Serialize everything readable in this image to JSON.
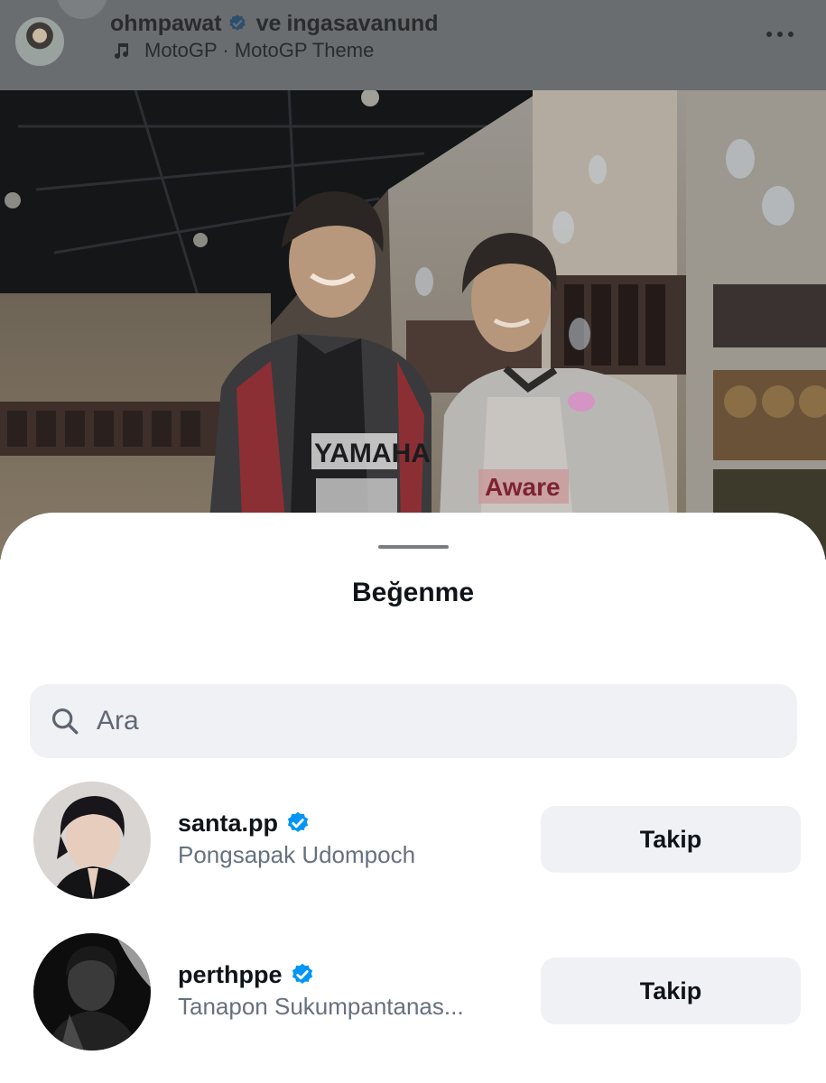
{
  "post_header": {
    "user_a": "ohmpawat",
    "joiner": "ve",
    "user_b": "ingasavanund",
    "music_label": "MotoGP · MotoGP Theme",
    "more_icon": "more-horizontal-icon",
    "note_icon": "music-note-icon"
  },
  "sheet": {
    "title": "Beğenme",
    "search": {
      "placeholder": "Ara",
      "value": "",
      "icon": "search-icon"
    }
  },
  "likers": [
    {
      "username": "santa.pp",
      "full_name": "Pongsapak Udompoch",
      "verified": true,
      "button_label": "Takip"
    },
    {
      "username": "perthppe",
      "full_name": "Tanapon Sukumpantanas...",
      "verified": true,
      "button_label": "Takip"
    }
  ],
  "colors": {
    "verified_blue": "#0095f6",
    "button_bg": "#eff1f4",
    "dim_overlay": "#6a6d70"
  }
}
